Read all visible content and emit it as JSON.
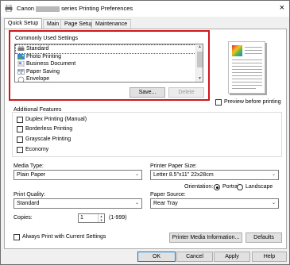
{
  "window": {
    "title_prefix": "Canon",
    "title_suffix": "series Printing Preferences",
    "close_glyph": "×"
  },
  "tabs": [
    {
      "label": "Quick Setup",
      "active": true
    },
    {
      "label": "Main",
      "active": false
    },
    {
      "label": "Page Setup",
      "active": false
    },
    {
      "label": "Maintenance",
      "active": false
    }
  ],
  "settings": {
    "label": "Commonly Used Settings",
    "items": [
      {
        "label": "Standard",
        "icon": "printer-icon"
      },
      {
        "label": "Photo Printing",
        "icon": "photo-icon"
      },
      {
        "label": "Business Document",
        "icon": "document-icon"
      },
      {
        "label": "Paper Saving",
        "icon": "paper-saving-icon"
      },
      {
        "label": "Envelope",
        "icon": "envelope-icon"
      }
    ],
    "save_label": "Save...",
    "delete_label": "Delete"
  },
  "preview": {
    "checkbox_label": "Preview before printing",
    "checked": false
  },
  "features": {
    "label": "Additional Features",
    "items": [
      {
        "label": "Duplex Printing (Manual)",
        "checked": false
      },
      {
        "label": "Borderless Printing",
        "checked": false
      },
      {
        "label": "Grayscale Printing",
        "checked": false
      },
      {
        "label": "Economy",
        "checked": false
      }
    ]
  },
  "media_type": {
    "label": "Media Type:",
    "value": "Plain Paper"
  },
  "paper_size": {
    "label": "Printer Paper Size:",
    "value": "Letter 8.5\"x11\" 22x28cm"
  },
  "orientation": {
    "label": "Orientation:",
    "portrait": "Portrait",
    "landscape": "Landscape",
    "selected": "Portrait"
  },
  "print_quality": {
    "label": "Print Quality:",
    "value": "Standard"
  },
  "paper_source": {
    "label": "Paper Source:",
    "value": "Rear Tray"
  },
  "copies": {
    "label": "Copies:",
    "value": "1",
    "range": "(1-999)"
  },
  "always_print": {
    "label": "Always Print with Current Settings",
    "checked": false
  },
  "buttons": {
    "media_info": "Printer Media Information...",
    "defaults": "Defaults",
    "ok": "OK",
    "cancel": "Cancel",
    "apply": "Apply",
    "help": "Help"
  },
  "colors": {
    "highlight_border": "#d0161a",
    "window_bg": "#f0f0f0"
  }
}
